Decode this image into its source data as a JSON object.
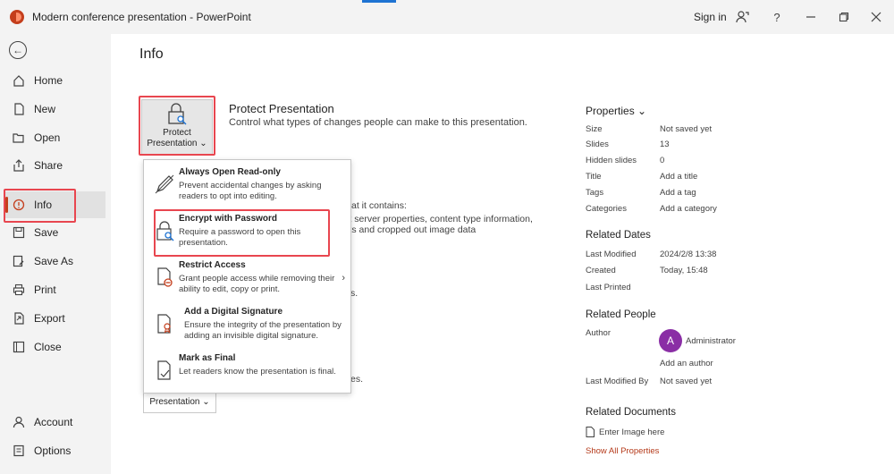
{
  "window": {
    "title": "Modern conference presentation  -  PowerPoint",
    "signin": "Sign in",
    "help_glyph": "?",
    "accent_color": "#c43e1c"
  },
  "sidebar": {
    "items": [
      {
        "label": "Home",
        "icon": "home-icon"
      },
      {
        "label": "New",
        "icon": "new-document-icon"
      },
      {
        "label": "Open",
        "icon": "folder-open-icon"
      },
      {
        "label": "Share",
        "icon": "share-icon"
      },
      {
        "label": "Info",
        "icon": "info-icon"
      },
      {
        "label": "Save",
        "icon": "save-icon"
      },
      {
        "label": "Save As",
        "icon": "save-as-icon"
      },
      {
        "label": "Print",
        "icon": "print-icon"
      },
      {
        "label": "Export",
        "icon": "export-icon"
      },
      {
        "label": "Close",
        "icon": "close-document-icon"
      }
    ],
    "bottom_items": [
      {
        "label": "Account",
        "icon": "account-icon"
      },
      {
        "label": "Options",
        "icon": "options-icon"
      }
    ]
  },
  "main": {
    "title": "Info",
    "protect": {
      "button_line1": "Protect",
      "button_line2": "Presentation ⌄",
      "title": "Protect Presentation",
      "description": "Control what types of changes people can make to this presentation."
    },
    "background_text": [
      "re that it contains:",
      "ment server properties, content type information,",
      "ments and cropped out image data",
      "s.",
      "es."
    ],
    "bottom_button": "Presentation ⌄"
  },
  "protect_menu": {
    "items": [
      {
        "title": "Always Open Read-only",
        "description": "Prevent accidental changes by asking readers to opt into editing.",
        "icon": "pencil-read-only-icon"
      },
      {
        "title": "Encrypt with Password",
        "description": "Require a password to open this presentation.",
        "icon": "lock-key-icon"
      },
      {
        "title": "Restrict Access",
        "description": "Grant people access while removing their ability to edit, copy or print.",
        "icon": "restrict-access-icon",
        "arrow": "›"
      },
      {
        "title": "Add a Digital Signature",
        "description": "Ensure the integrity of the presentation by adding an invisible digital signature.",
        "icon": "digital-signature-icon"
      },
      {
        "title": "Mark as Final",
        "description": "Let readers know the presentation is final.",
        "icon": "mark-final-icon"
      }
    ]
  },
  "properties": {
    "heading": "Properties ⌄",
    "rows": [
      {
        "label": "Size",
        "value": "Not saved yet"
      },
      {
        "label": "Slides",
        "value": "13"
      },
      {
        "label": "Hidden slides",
        "value": "0"
      },
      {
        "label": "Title",
        "value": "Add a title"
      },
      {
        "label": "Tags",
        "value": "Add a tag"
      },
      {
        "label": "Categories",
        "value": "Add a category"
      }
    ],
    "dates_heading": "Related Dates",
    "dates": [
      {
        "label": "Last Modified",
        "value": "2024/2/8 13:38"
      },
      {
        "label": "Created",
        "value": "Today, 15:48"
      },
      {
        "label": "Last Printed",
        "value": ""
      }
    ],
    "people_heading": "Related People",
    "author_label": "Author",
    "author_initial": "A",
    "author_name": "Administrator",
    "add_author": "Add an author",
    "last_modified_by_label": "Last Modified By",
    "last_modified_by_value": "Not saved yet",
    "docs_heading": "Related Documents",
    "enter_image": "Enter Image here",
    "show_all": "Show All Properties"
  }
}
